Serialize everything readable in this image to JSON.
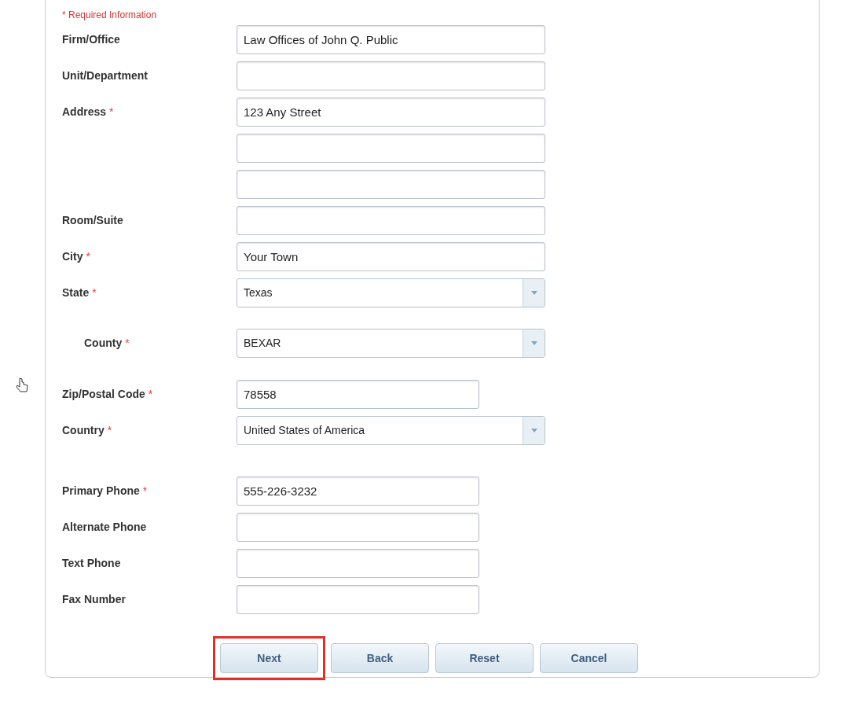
{
  "required_note": "* Required Information",
  "sections": [
    {
      "fields": [
        {
          "label": "Firm/Office",
          "kind": "text",
          "value": "Law Offices of John Q. Public"
        },
        {
          "label": "Unit/Department",
          "kind": "text"
        },
        {
          "label": "Address",
          "required_mark": "*",
          "kind": "text",
          "value": "123 Any Street"
        },
        {
          "kind": "text"
        },
        {
          "kind": "text"
        },
        {
          "label": "Room/Suite",
          "kind": "text"
        },
        {
          "label": "City",
          "required_mark": "*",
          "kind": "text",
          "value": "Your Town"
        },
        {
          "label": "State",
          "required_mark": "*",
          "kind": "select",
          "value": "Texas",
          "children": [
            {
              "label": "County",
              "required_mark": "*",
              "kind": "select",
              "value": "BEXAR"
            }
          ]
        }
      ]
    },
    {
      "fields": [
        {
          "label": "Zip/Postal Code",
          "required_mark": "*",
          "kind": "short",
          "value": "78558"
        },
        {
          "label": "Country",
          "required_mark": "*",
          "kind": "select",
          "value": "United States of America"
        }
      ]
    },
    {
      "fields": [
        {
          "label": "Primary Phone",
          "required_mark": "*",
          "kind": "short",
          "value": "555-226-3232"
        },
        {
          "label": "Alternate Phone",
          "kind": "short"
        },
        {
          "label": "Text Phone",
          "kind": "short"
        },
        {
          "label": "Fax Number",
          "kind": "short"
        }
      ]
    }
  ],
  "buttons": [
    {
      "label": "Next",
      "highlighted": true
    },
    {
      "label": "Back",
      "highlighted": false
    },
    {
      "label": "Reset",
      "highlighted": false
    },
    {
      "label": "Cancel",
      "highlighted": false
    }
  ]
}
